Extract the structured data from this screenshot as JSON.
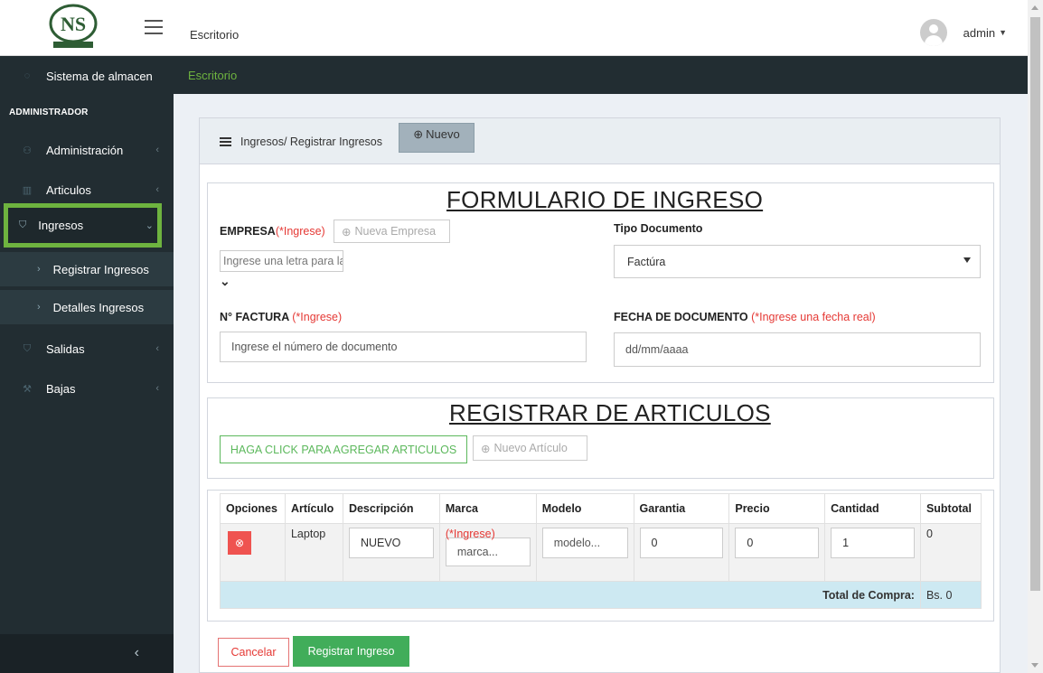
{
  "header": {
    "title": "Escritorio",
    "user": "admin"
  },
  "sidebar": {
    "system": "Sistema de almacen",
    "section": "ADMINISTRADOR",
    "items": [
      {
        "label": "Administración"
      },
      {
        "label": "Articulos"
      },
      {
        "label": "Ingresos"
      },
      {
        "label": "Salidas"
      },
      {
        "label": "Bajas"
      }
    ],
    "subitems": [
      {
        "label": "Registrar Ingresos"
      },
      {
        "label": "Detalles Ingresos"
      }
    ],
    "active_color": "#6eb33f"
  },
  "breadcrumb": "Escritorio",
  "panel": {
    "title": "Ingresos/ Registrar Ingresos",
    "new_button": "Nuevo"
  },
  "form": {
    "title": "FORMULARIO DE INGRESO",
    "empresa_label": "EMPRESA",
    "empresa_req": "(*Ingrese)",
    "nueva_empresa": "Nueva Empresa",
    "empresa_placeholder": "Ingrese una letra para la",
    "tipo_label": "Tipo Documento",
    "tipo_value": "Factúra",
    "factura_label": "N° FACTURA",
    "factura_req": "(*Ingrese)",
    "factura_placeholder": "Ingrese el número de documento",
    "fecha_label": "FECHA DE DOCUMENTO",
    "fecha_req": "(*Ingrese una fecha real)",
    "fecha_placeholder": "dd/mm/aaaa"
  },
  "articles": {
    "title": "REGISTRAR DE ARTICULOS",
    "add_button": "HAGA CLICK PARA AGREGAR ARTICULOS",
    "new_article": "Nuevo Artículo",
    "columns": [
      "Opciones",
      "Artículo",
      "Descripción",
      "Marca",
      "Modelo",
      "Garantia",
      "Precio",
      "Cantidad",
      "Subtotal"
    ],
    "row": {
      "articulo": "Laptop",
      "descripcion": "NUEVO",
      "marca_req": "(*Ingrese)",
      "marca_placeholder": "marca...",
      "modelo_placeholder": "modelo...",
      "garantia": "0",
      "precio": "0",
      "cantidad": "1",
      "subtotal": "0"
    },
    "total_label": "Total de Compra:",
    "total_value": "Bs. 0"
  },
  "actions": {
    "cancel": "Cancelar",
    "save": "Registrar Ingreso"
  }
}
